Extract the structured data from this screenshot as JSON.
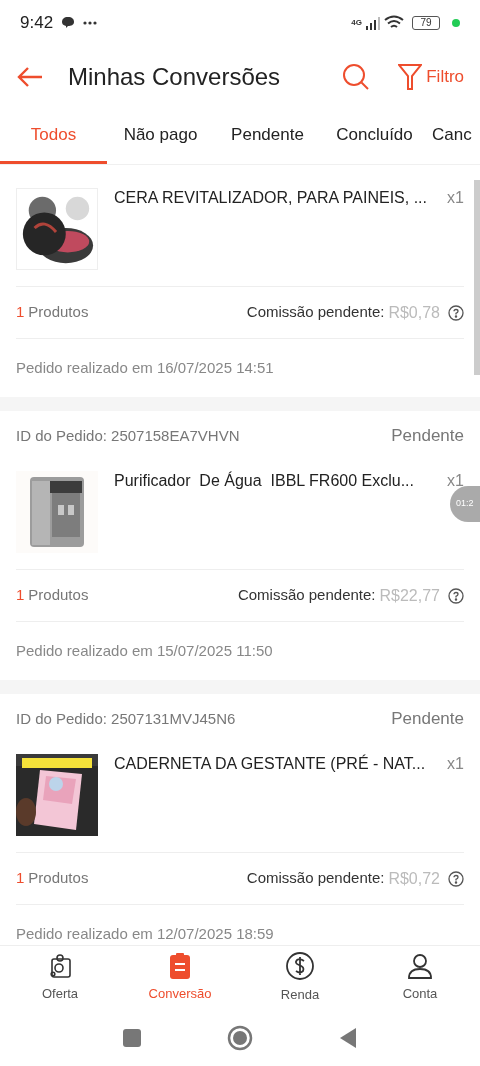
{
  "status_bar": {
    "time": "9:42",
    "network": "4G",
    "battery": "79"
  },
  "header": {
    "title": "Minhas Conversões",
    "filter_label": "Filtro"
  },
  "tabs": [
    {
      "label": "Todos",
      "selected": true
    },
    {
      "label": "Não pago",
      "selected": false
    },
    {
      "label": "Pendente",
      "selected": false
    },
    {
      "label": "Concluído",
      "selected": false
    },
    {
      "label": "Canc",
      "selected": false
    }
  ],
  "orders": [
    {
      "product": "CERA REVITALIZADOR, PARA PAINEIS, ...",
      "quantity": "x1",
      "count": "1",
      "count_label": "Produtos",
      "commission_label": "Comissão pendente:",
      "commission": "R$0,78",
      "date": "Pedido realizado em 16/07/2025 14:51"
    },
    {
      "order_id": "ID do Pedido: 2507158EA7VHVN",
      "status": "Pendente",
      "product": "Purificador  De Água  IBBL FR600 Exclu...",
      "quantity": "x1",
      "count": "1",
      "count_label": "Produtos",
      "commission_label": "Comissão pendente:",
      "commission": "R$22,77",
      "date": "Pedido realizado em 15/07/2025 11:50"
    },
    {
      "order_id": "ID do Pedido: 2507131MVJ45N6",
      "status": "Pendente",
      "product": "CADERNETA DA GESTANTE (PRÉ - NAT...",
      "quantity": "x1",
      "count": "1",
      "count_label": "Produtos",
      "commission_label": "Comissão pendente:",
      "commission": "R$0,72",
      "date": "Pedido realizado em 12/07/2025 18:59"
    }
  ],
  "timer_bubble": "01:2",
  "bottom_nav": [
    {
      "label": "Oferta",
      "selected": false
    },
    {
      "label": "Conversão",
      "selected": true
    },
    {
      "label": "Renda",
      "selected": false
    },
    {
      "label": "Conta",
      "selected": false
    }
  ]
}
